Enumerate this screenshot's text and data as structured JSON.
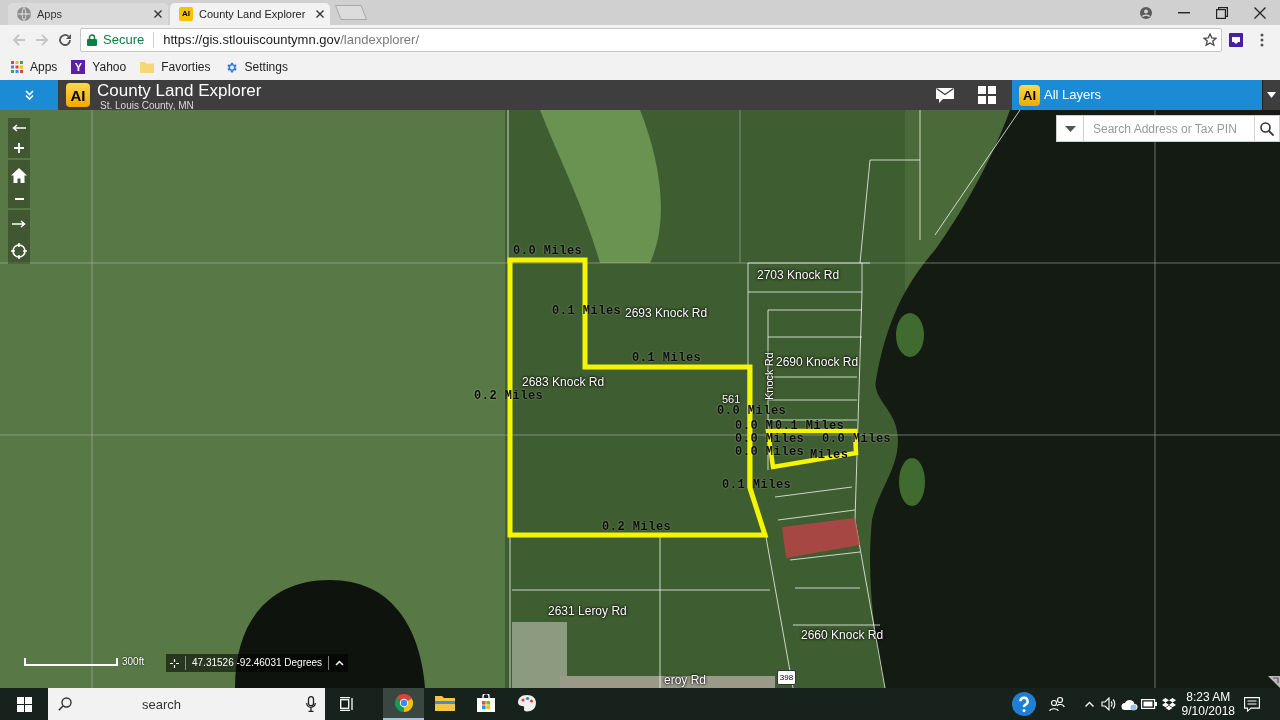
{
  "browser": {
    "tabs": [
      {
        "title": "Apps",
        "selected": false,
        "favicon": {
          "kind": "globe"
        }
      },
      {
        "title": "County Land Explorer",
        "selected": true,
        "favicon": {
          "kind": "text",
          "text": "AI"
        }
      }
    ],
    "navigation": {
      "back": {
        "disabled": true
      },
      "forward": {
        "disabled": true
      }
    },
    "address_bar": {
      "security": "Secure",
      "url": {
        "host": "https://gis.stlouiscountymn.gov",
        "path": "/landexplorer/"
      }
    },
    "bookmarks": [
      {
        "kind": "apps",
        "label": "Apps"
      },
      {
        "kind": "logo",
        "logo_text": "Y",
        "label": "Yahoo"
      },
      {
        "kind": "folder",
        "label": "Favorties"
      },
      {
        "kind": "settings",
        "label": "Settings"
      }
    ]
  },
  "app_header": {
    "logo_text": "AI",
    "title": "County Land Explorer",
    "subtitle": "St. Louis County, MN",
    "layer_picker": {
      "logo_text": "AI",
      "label": "All Layers"
    }
  },
  "map": {
    "search": {
      "placeholder": "Search Address or Tax PIN"
    },
    "labels": [
      {
        "kind": "measure",
        "text": "0.0 Miles"
      },
      {
        "kind": "parcel",
        "text": "2703 Knock Rd"
      },
      {
        "kind": "measure",
        "text": "0.1 Miles"
      },
      {
        "kind": "parcel",
        "text": "2693 Knock Rd"
      },
      {
        "kind": "parcel",
        "text": "2690 Knock Rd"
      },
      {
        "kind": "measure",
        "text": "0.1 Miles"
      },
      {
        "kind": "parcel",
        "text": "2683 Knock Rd"
      },
      {
        "kind": "measure",
        "text": "0.2 Miles"
      },
      {
        "kind": "road",
        "text": "Knock Rd"
      },
      {
        "kind": "number",
        "text": "561"
      },
      {
        "kind": "measure",
        "text": "0.0 Miles"
      },
      {
        "kind": "measure",
        "text": "0.0 M"
      },
      {
        "kind": "measure",
        "text": "0.1 Miles"
      },
      {
        "kind": "measure",
        "text": "0.0 Miles"
      },
      {
        "kind": "measure",
        "text": "0.0 Miles"
      },
      {
        "kind": "measure",
        "text": "0.0 Miles"
      },
      {
        "kind": "measure",
        "text": "Miles"
      },
      {
        "kind": "measure",
        "text": "0.1 Miles"
      },
      {
        "kind": "measure",
        "text": "0.2 Miles"
      },
      {
        "kind": "parcel",
        "text": "2631 Leroy Rd"
      },
      {
        "kind": "parcel",
        "text": "2660 Knock Rd"
      },
      {
        "kind": "parcel",
        "text": "eroy Rd"
      }
    ],
    "route_shield": "398",
    "scale": "300ft",
    "coordinates": "47.31526 -92.46031 Degrees"
  },
  "taskbar": {
    "search": {
      "placeholder": "search"
    },
    "apps": [
      {
        "kind": "browser",
        "selected": true
      },
      {
        "kind": "files",
        "selected": false
      },
      {
        "kind": "store",
        "selected": false
      },
      {
        "kind": "paint",
        "selected": false
      }
    ],
    "clock": {
      "time": "8:23 AM",
      "date": "9/10/2018"
    }
  }
}
